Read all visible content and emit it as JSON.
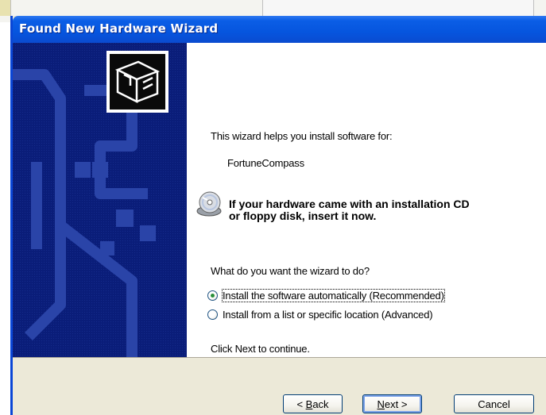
{
  "window": {
    "title": "Found New Hardware Wizard"
  },
  "content": {
    "intro": "This wizard helps you install software for:",
    "device_name": "FortuneCompass",
    "cd_note_line1": "If your hardware came with an installation CD",
    "cd_note_line2": "or floppy disk, insert it now.",
    "question": "What do you want the wizard to do?",
    "options": [
      {
        "label": "Install the software automatically (Recommended)",
        "selected": true
      },
      {
        "label": "Install from a list or specific location (Advanced)",
        "selected": false
      }
    ],
    "footer": "Click Next to continue."
  },
  "buttons": {
    "back_prefix": "< ",
    "back_key": "B",
    "back_rest": "ack",
    "next_key": "N",
    "next_rest": "ext >",
    "cancel": "Cancel"
  },
  "colors": {
    "titlebar": "#0655de",
    "sidebar": "#0b1e7a",
    "dialog_face": "#ece9d8"
  },
  "icons": {
    "wizard": "hardware-box-icon",
    "cd": "cd-disc-icon"
  }
}
